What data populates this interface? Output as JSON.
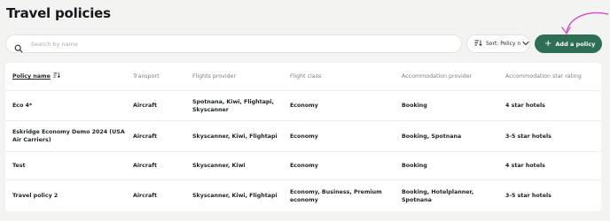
{
  "page": {
    "title": "Travel policies"
  },
  "search": {
    "placeholder": "Search by name",
    "value": ""
  },
  "sort": {
    "label": "Sort: Policy n"
  },
  "add_policy": {
    "label": "Add a policy"
  },
  "colors": {
    "accent": "#2e6e55",
    "annotation_arrow": "#d63ac9"
  },
  "table": {
    "headers": [
      "Policy name",
      "Transport",
      "Flights provider",
      "Flight class",
      "Accommodation provider",
      "Accommodation star rating"
    ],
    "rows": [
      [
        "Eco 4*",
        "Aircraft",
        "Spotnana, Kiwi, Flightapi, Skyscanner",
        "Economy",
        "Booking",
        "4 star hotels"
      ],
      [
        "Eskridge Economy Demo 2024 (USA Air Carriers)",
        "Aircraft",
        "Skyscanner, Kiwi, Flightapi",
        "Economy",
        "Booking, Spotnana",
        "3-5 star hotels"
      ],
      [
        "Test",
        "Aircraft",
        "Skyscanner, Kiwi",
        "Economy",
        "Booking",
        "4 star hotels"
      ],
      [
        "Travel policy 2",
        "Aircraft",
        "Skyscanner, Kiwi, Flightapi",
        "Economy, Business, Premium economy",
        "Booking, Hotelplanner, Spotnana",
        "3-5 star hotels"
      ]
    ]
  }
}
